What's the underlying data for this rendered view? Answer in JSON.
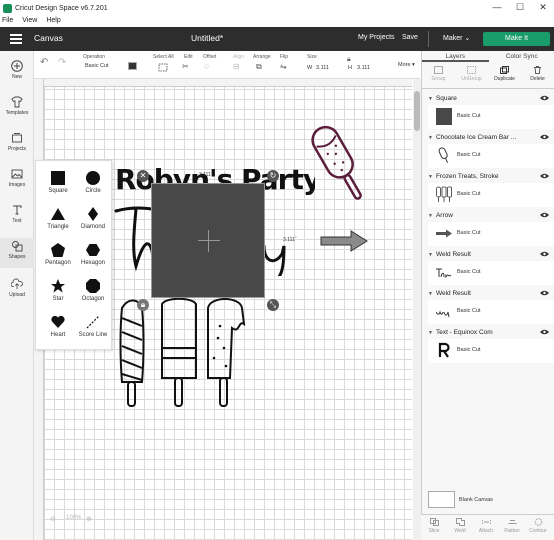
{
  "window": {
    "title": "Cricut Design Space  v6.7.201",
    "controls": {
      "minimize": "—",
      "maximize": "☐",
      "close": "✕"
    }
  },
  "menu": [
    "File",
    "View",
    "Help"
  ],
  "header": {
    "section": "Canvas",
    "document": "Untitled*",
    "my_projects": "My Projects",
    "save": "Save",
    "machine": "Maker",
    "machine_caret": "⌄",
    "make_it": "Make It",
    "make_it_color": "#1a9b6a"
  },
  "toolbar": {
    "operation_label": "Operation",
    "operation_value": "Basic Cut",
    "select_all": "Select All",
    "edit": "Edit",
    "offset": "Offset",
    "align": "Align",
    "arrange": "Arrange",
    "flip": "Flip",
    "size": "Size",
    "size_w_label": "W",
    "size_w": "3.111",
    "size_h_label": "H",
    "size_h": "3.111",
    "more": "More ▾"
  },
  "left_sidebar": [
    {
      "icon": "plus-icon",
      "label": "New"
    },
    {
      "icon": "shirt-icon",
      "label": "Templates"
    },
    {
      "icon": "projects-icon",
      "label": "Projects"
    },
    {
      "icon": "images-icon",
      "label": "Images"
    },
    {
      "icon": "text-icon",
      "label": "Text"
    },
    {
      "icon": "shapes-icon",
      "label": "Shapes"
    },
    {
      "icon": "upload-icon",
      "label": "Upload"
    }
  ],
  "shapes_panel": [
    {
      "name": "square",
      "label": "Square"
    },
    {
      "name": "circle",
      "label": "Circle"
    },
    {
      "name": "triangle",
      "label": "Triangle"
    },
    {
      "name": "diamond",
      "label": "Diamond"
    },
    {
      "name": "pentagon",
      "label": "Pentagon"
    },
    {
      "name": "hexagon",
      "label": "Hexagon"
    },
    {
      "name": "star",
      "label": "Star"
    },
    {
      "name": "octagon",
      "label": "Octagon"
    },
    {
      "name": "heart",
      "label": "Heart"
    },
    {
      "name": "score-line",
      "label": "Score Line"
    }
  ],
  "canvas": {
    "title_text": "Robyn's Party",
    "selection_dim": "3.111˝",
    "zoom": "100%"
  },
  "layers_panel": {
    "tabs": [
      "Layers",
      "Color Sync"
    ],
    "actions": [
      "Group",
      "UnGroup",
      "Duplicate",
      "Delete"
    ],
    "layers": [
      {
        "name": "Square",
        "operation": "Basic Cut",
        "thumb": "square"
      },
      {
        "name": "Chocolate Ice Cream Bar ...",
        "operation": "Basic Cut",
        "thumb": "icecream"
      },
      {
        "name": "Frozen Treats, Stroke",
        "operation": "Basic Cut",
        "thumb": "popsicles"
      },
      {
        "name": "Arrow",
        "operation": "Basic Cut",
        "thumb": "arrow"
      },
      {
        "name": "Weld Result",
        "operation": "Basic Cut",
        "thumb": "script1"
      },
      {
        "name": "Weld Result",
        "operation": "Basic Cut",
        "thumb": "script2"
      },
      {
        "name": "Text - Equinox Com",
        "operation": "Basic Cut",
        "thumb": "R"
      }
    ],
    "blank_canvas": "Blank Canvas",
    "bottom_actions": [
      "Slice",
      "Weld",
      "Attach",
      "Flatten",
      "Contour"
    ]
  }
}
